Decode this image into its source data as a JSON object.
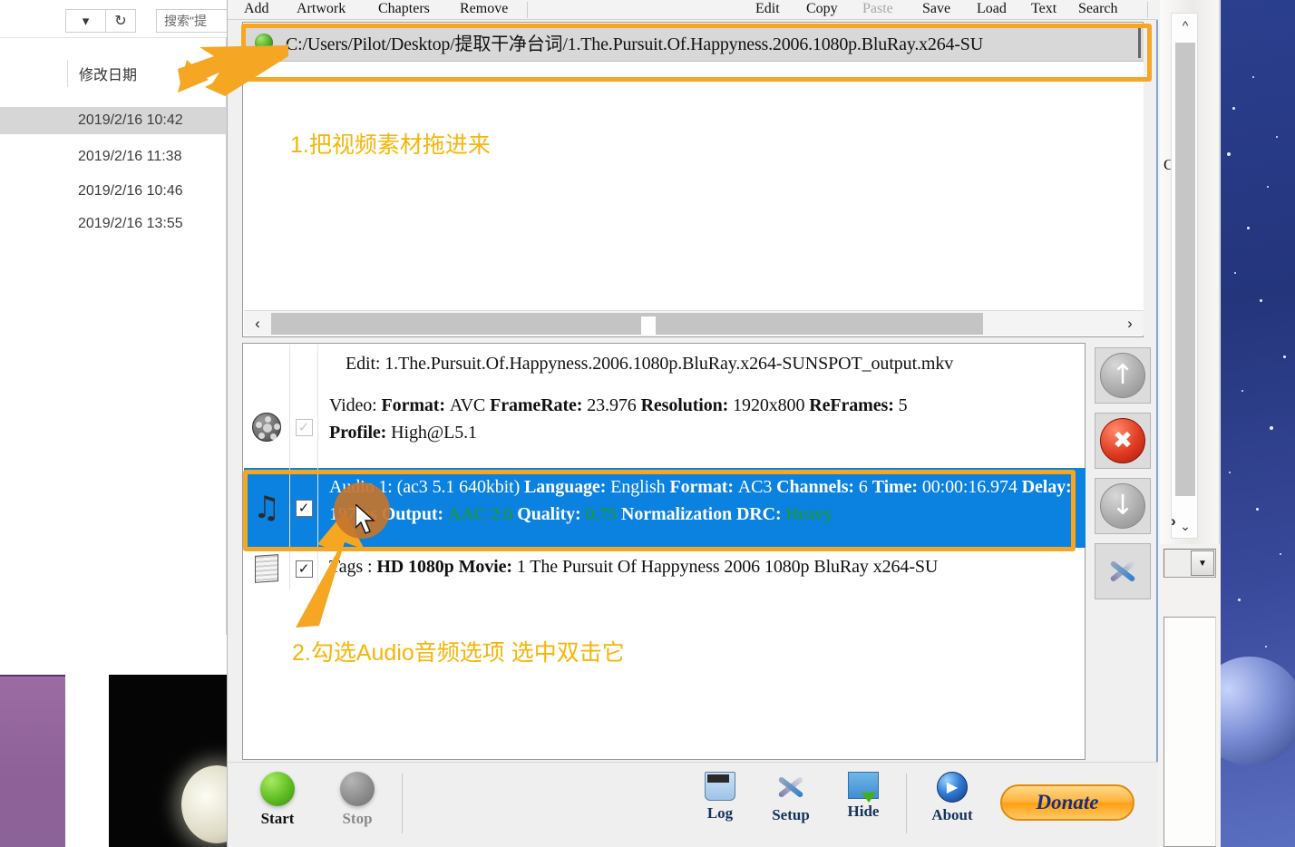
{
  "explorer": {
    "search_placeholder": "搜索\"提",
    "column_header": "修改日期",
    "rows": [
      {
        "date": "2019/2/16 10:42",
        "selected": true
      },
      {
        "date": "2019/2/16 11:38",
        "selected": false
      },
      {
        "date": "2019/2/16 10:46",
        "selected": false
      },
      {
        "date": "2019/2/16 13:55",
        "selected": false
      }
    ],
    "refresh_icon": "refresh-icon",
    "caret_icon": "chevron-down-icon"
  },
  "background_window": {
    "letter": "C"
  },
  "app": {
    "menu_left": [
      {
        "label": "Add"
      },
      {
        "label": "Artwork"
      },
      {
        "label": "Chapters"
      },
      {
        "label": "Remove"
      }
    ],
    "menu_right": [
      {
        "label": "Edit",
        "disabled": false
      },
      {
        "label": "Copy",
        "disabled": false
      },
      {
        "label": "Paste",
        "disabled": true
      },
      {
        "label": "Save",
        "disabled": false
      },
      {
        "label": "Load",
        "disabled": false
      },
      {
        "label": "Text",
        "disabled": false
      },
      {
        "label": "Search",
        "disabled": false
      }
    ],
    "source": {
      "status_icon": "green-status-dot",
      "path": "C:/Users/Pilot/Desktop/提取干净台词/1.The.Pursuit.Of.Happyness.2006.1080p.BluRay.x264-SU",
      "hscroll_left_icon": "chevron-left-icon",
      "hscroll_right_icon": "chevron-right-icon"
    },
    "tracks": [
      {
        "name": "edit-row",
        "icon": "film-reel-icon",
        "checked": false,
        "checkbox_disabled": true,
        "selected": false,
        "lines": [
          [
            {
              "t": "Edit: 1.The.Pursuit.Of.Happyness.2006.1080p.BluRay.x264-SUNSPOT_output.mkv",
              "b": false,
              "c": "normal"
            }
          ]
        ]
      },
      {
        "name": "video-row",
        "icon": "film-reel-icon",
        "checked": false,
        "checkbox_disabled": true,
        "selected": false,
        "lines": [
          [
            {
              "t": "Video: ",
              "b": false,
              "c": "normal"
            },
            {
              "t": "Format: ",
              "b": true,
              "c": "normal"
            },
            {
              "t": "AVC ",
              "b": false,
              "c": "normal"
            },
            {
              "t": "FrameRate: ",
              "b": true,
              "c": "normal"
            },
            {
              "t": "23.976 ",
              "b": false,
              "c": "normal"
            },
            {
              "t": "Resolution: ",
              "b": true,
              "c": "normal"
            },
            {
              "t": "1920x800 ",
              "b": false,
              "c": "normal"
            },
            {
              "t": "ReFrames: ",
              "b": true,
              "c": "normal"
            },
            {
              "t": "5",
              "b": false,
              "c": "normal"
            }
          ],
          [
            {
              "t": "Profile: ",
              "b": true,
              "c": "normal"
            },
            {
              "t": "High@L5.1",
              "b": false,
              "c": "normal"
            }
          ]
        ]
      },
      {
        "name": "audio-row",
        "icon": "music-note-icon",
        "checked": true,
        "checkbox_disabled": false,
        "selected": true,
        "lines": [
          [
            {
              "t": "Audio 1: (ac3 5.1 640kbit) ",
              "b": false,
              "c": "normal"
            },
            {
              "t": "Language: ",
              "b": true,
              "c": "normal"
            },
            {
              "t": "English ",
              "b": false,
              "c": "normal"
            },
            {
              "t": "Format: ",
              "b": true,
              "c": "normal"
            },
            {
              "t": "AC3 ",
              "b": false,
              "c": "normal"
            },
            {
              "t": "Channels: ",
              "b": true,
              "c": "normal"
            },
            {
              "t": "6 ",
              "b": false,
              "c": "normal"
            },
            {
              "t": "Time: ",
              "b": true,
              "c": "normal"
            },
            {
              "t": "00:00:16.974 ",
              "b": false,
              "c": "normal"
            },
            {
              "t": "Delay: ",
              "b": true,
              "c": "normal"
            },
            {
              "t": "197ms ",
              "b": false,
              "c": "normal"
            },
            {
              "t": "Output: ",
              "b": true,
              "c": "green"
            },
            {
              "t": "AAC 2.0 ",
              "b": false,
              "c": "green"
            },
            {
              "t": "Quality: ",
              "b": true,
              "c": "green"
            },
            {
              "t": "0.75 ",
              "b": false,
              "c": "green"
            },
            {
              "t": "Normalization DRC: ",
              "b": true,
              "c": "green"
            },
            {
              "t": "Heavy",
              "b": false,
              "c": "green"
            }
          ]
        ]
      },
      {
        "name": "tags-row",
        "icon": "document-icon",
        "checked": true,
        "checkbox_disabled": false,
        "selected": false,
        "lines": [
          [
            {
              "t": "Tags : ",
              "b": false,
              "c": "normal"
            },
            {
              "t": "HD 1080p Movie: ",
              "b": true,
              "c": "normal"
            },
            {
              "t": "1 The Pursuit Of Happyness 2006 1080p BluRay x264-SU",
              "b": false,
              "c": "normal"
            }
          ]
        ]
      }
    ],
    "side_buttons": [
      {
        "name": "move-up-button",
        "icon": "arrow-up-icon",
        "glyph": "↑",
        "style": "gray"
      },
      {
        "name": "delete-button",
        "icon": "red-x-icon",
        "glyph": "✖",
        "style": "red"
      },
      {
        "name": "move-down-button",
        "icon": "arrow-down-icon",
        "glyph": "↓",
        "style": "gray"
      },
      {
        "name": "track-settings-button",
        "icon": "tools-icon",
        "glyph": "",
        "style": "tools"
      }
    ],
    "bottom_bar": [
      {
        "name": "start-button",
        "label": "Start",
        "icon": "green-circle-icon",
        "label_style": "dark"
      },
      {
        "name": "stop-button",
        "label": "Stop",
        "icon": "gray-circle-icon",
        "label_style": "gray"
      },
      {
        "name": "log-button",
        "label": "Log",
        "icon": "log-icon",
        "label_style": "blue"
      },
      {
        "name": "setup-button",
        "label": "Setup",
        "icon": "tools-icon",
        "label_style": "blue"
      },
      {
        "name": "hide-button",
        "label": "Hide",
        "icon": "hide-window-icon",
        "label_style": "blue"
      },
      {
        "name": "about-button",
        "label": "About",
        "icon": "play-circle-icon",
        "label_style": "blue"
      }
    ],
    "donate_label": "Donate"
  },
  "annotations": [
    {
      "name": "annotation-step-1",
      "text": "1.把视频素材拖进来"
    },
    {
      "name": "annotation-step-2",
      "text": "2.勾选Audio音频选项  选中双击它"
    }
  ],
  "colors": {
    "annotation": "#f5b50a",
    "highlight_box": "#f5a623",
    "selection_blue": "#0b81e0",
    "green_text": "#13a013",
    "donate_orange": "#ffb23c"
  }
}
